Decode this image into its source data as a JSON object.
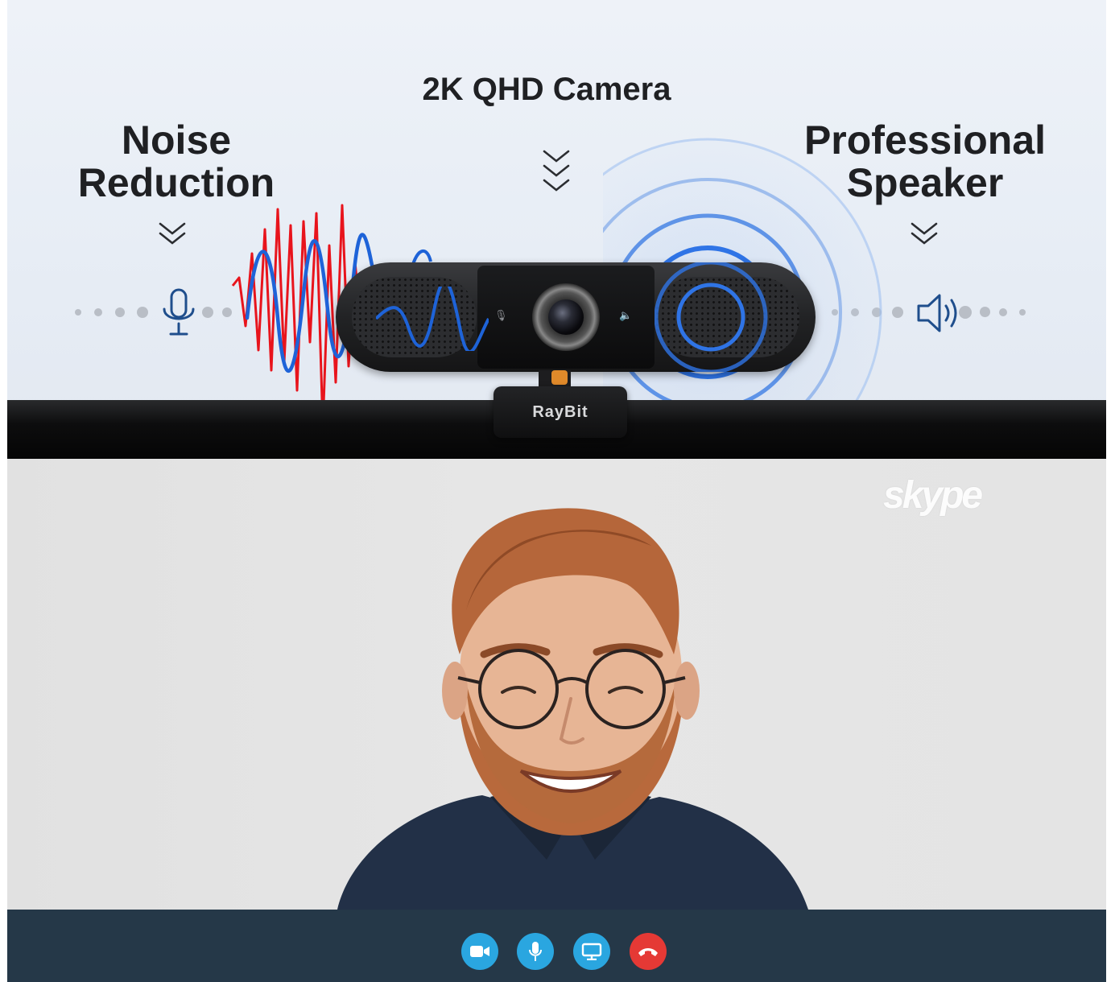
{
  "features": {
    "camera_title": "2K QHD Camera",
    "noise_title_line1": "Noise",
    "noise_title_line2": "Reduction",
    "speaker_title_line1": "Professional",
    "speaker_title_line2": "Speaker"
  },
  "product": {
    "brand": "RayBit"
  },
  "call": {
    "watermark": "skype",
    "controls": [
      {
        "name": "video",
        "icon": "video-camera-icon",
        "color": "#2aa6e0"
      },
      {
        "name": "microphone",
        "icon": "microphone-icon",
        "color": "#2aa6e0"
      },
      {
        "name": "screen-share",
        "icon": "screen-share-icon",
        "color": "#2aa6e0"
      },
      {
        "name": "end-call",
        "icon": "hang-up-icon",
        "color": "#e53935"
      }
    ]
  },
  "colors": {
    "wave_red": "#e8141c",
    "wave_blue": "#1e63d8",
    "ripple_blue": "#2f74e6",
    "call_bar": "#253848"
  }
}
